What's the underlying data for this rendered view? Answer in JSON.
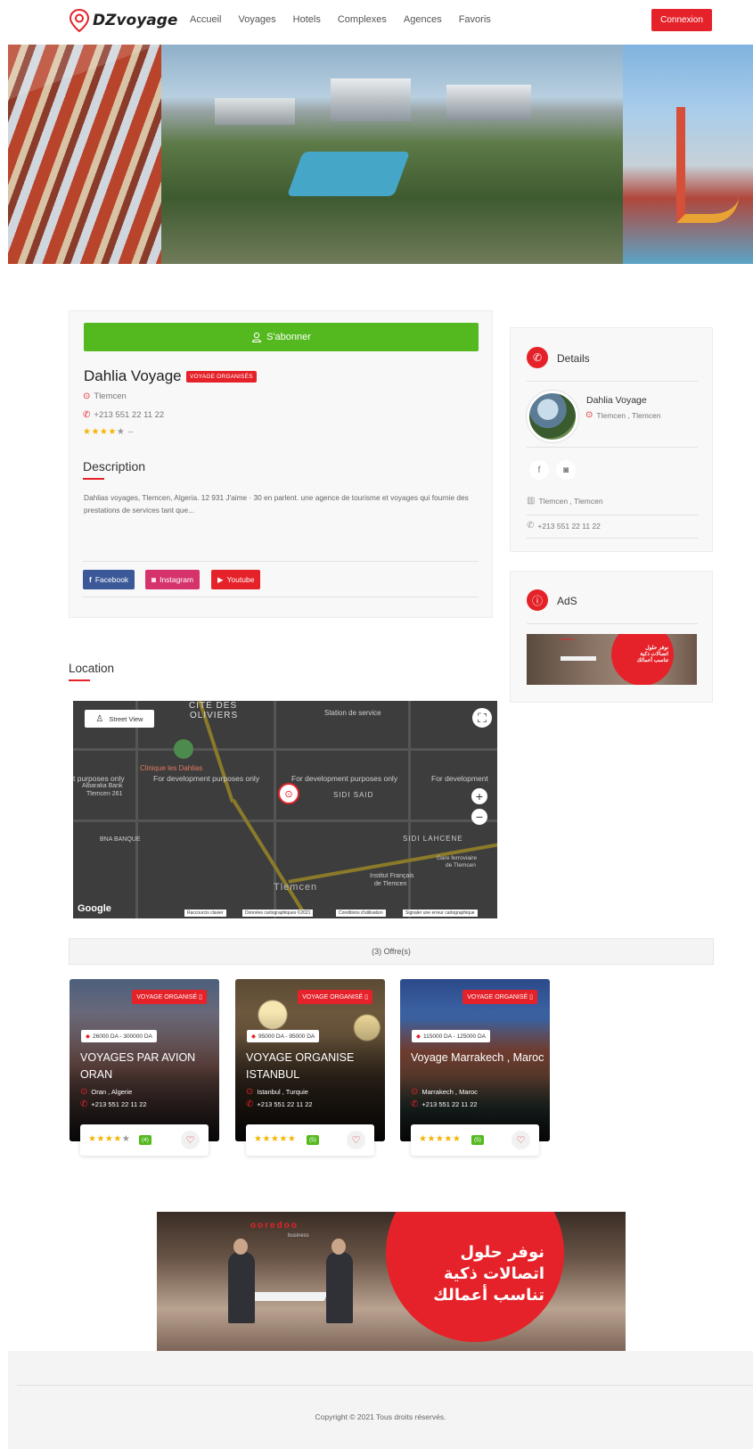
{
  "header": {
    "brand": "DZvoyage",
    "nav": [
      "Accueil",
      "Voyages",
      "Hotels",
      "Complexes",
      "Agences",
      "Favoris"
    ],
    "login_label": "Connexion"
  },
  "agency": {
    "subscribe_label": "S'abonner",
    "name": "Dahlia Voyage",
    "category": "VOYAGE ORGANISÉS",
    "city": "Tlemcen",
    "phone": "+213 551 22 11 22",
    "rating": 4,
    "rating_suffix": "–",
    "description_title": "Description",
    "description": "Dahlias voyages, Tlemcen, Algeria. 12 931 J'aime · 30 en parlent. une agence de tourisme et voyages qui fournie des prestations de services tant que...",
    "social": {
      "facebook": "Facebook",
      "instagram": "Instagram",
      "youtube": "Youtube"
    }
  },
  "sidebar": {
    "details_title": "Details",
    "name": "Dahlia Voyage",
    "location": "Tlemcen , Tlemcen",
    "address": "Tlemcen , Tlemcen",
    "phone": "+213 551 22 11 22",
    "ads_title": "AdS"
  },
  "location": {
    "title": "Location",
    "street_view": "Street View",
    "labels": {
      "cite1": "CITÉ DES",
      "cite2": "OLIVIERS",
      "station": "Station de service",
      "clinique": "Clinique les Dahlias",
      "albaraka1": "Albaraka Bank",
      "albaraka2": "Tlemcen 261",
      "dev1": "t purposes only",
      "dev2": "For development purposes only",
      "dev3": "For development purposes only",
      "dev4": "For development",
      "sidi_said": "SIDI SAID",
      "bna": "BNA BANQUE",
      "sidi_lahcene": "SIDI LAHCENE",
      "gare1": "Gare ferroviaire",
      "gare2": "de Tlemcen",
      "institut1": "Institut Français",
      "institut2": "de Tlemcen",
      "city": "Tlemcen"
    },
    "footer": {
      "google": "Google",
      "shortcuts": "Raccourcis clavier",
      "map_data": "Données cartographiques ©2021",
      "terms": "Conditions d'utilisation",
      "report": "Signaler une erreur cartographique"
    }
  },
  "offers": {
    "count_label": "(3) Offre(s)",
    "items": [
      {
        "category": "VOYAGE ORGANISÉ",
        "price": "26000 DA - 300000 DA",
        "title": "VOYAGES PAR AVION ORAN",
        "location": "Oran , Algerie",
        "phone": "+213 551 22 11 22",
        "rating": 4,
        "reviews": "(4)"
      },
      {
        "category": "VOYAGE ORGANISÉ",
        "price": "95000 DA - 95000 DA",
        "title": "VOYAGE ORGANISE ISTANBUL",
        "location": "Istanbul , Turquie",
        "phone": "+213 551 22 11 22",
        "rating": 5,
        "reviews": "(5)"
      },
      {
        "category": "VOYAGE ORGANISÉ",
        "price": "115000 DA - 125000 DA",
        "title": "Voyage Marrakech , Maroc",
        "location": "Marrakech , Maroc",
        "phone": "+213 551 22 11 22",
        "rating": 5,
        "reviews": "(5)"
      }
    ]
  },
  "ad": {
    "brand": "ooredoo",
    "brand_sub": "business",
    "line1": "نوفر حلول",
    "line2": "اتصالات ذكية",
    "line3": "تناسب أعمالك"
  },
  "footer": {
    "copyright": "Copyright © 2021 Tous droits réservés."
  },
  "colors": {
    "accent": "#e52229",
    "green": "#54b91f",
    "facebook": "#3b5998",
    "instagram": "#d6336c",
    "youtube": "#e52229"
  }
}
